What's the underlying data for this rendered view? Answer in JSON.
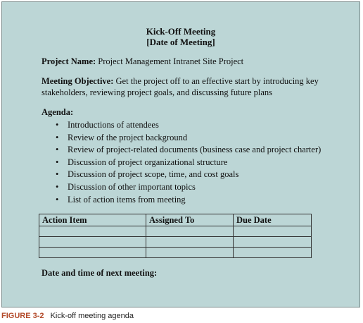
{
  "meeting": {
    "title": "Kick-Off Meeting",
    "date_placeholder": "[Date of Meeting]"
  },
  "project_name": {
    "label": "Project Name:",
    "value": "Project Management Intranet Site Project"
  },
  "meeting_objective": {
    "label": "Meeting Objective:",
    "line1": "Get the project off to an effective start by introducing key",
    "line2": "stakeholders, reviewing project goals, and discussing future plans"
  },
  "agenda": {
    "label": "Agenda:",
    "items": [
      "Introductions of attendees",
      "Review of the project background",
      "Review of project-related documents (business case and project charter)",
      "Discussion of project organizational structure",
      "Discussion of project scope, time, and cost goals",
      "Discussion of other important topics",
      "List of action items from meeting"
    ]
  },
  "action_table": {
    "headers": [
      "Action Item",
      "Assigned To",
      "Due Date"
    ],
    "rows": [
      [
        "",
        "",
        ""
      ],
      [
        "",
        "",
        ""
      ],
      [
        "",
        "",
        ""
      ]
    ]
  },
  "next_meeting": {
    "label": "Date and time of next meeting:"
  },
  "caption": {
    "figure": "FIGURE 3-2",
    "text": "Kick-off meeting agenda"
  }
}
